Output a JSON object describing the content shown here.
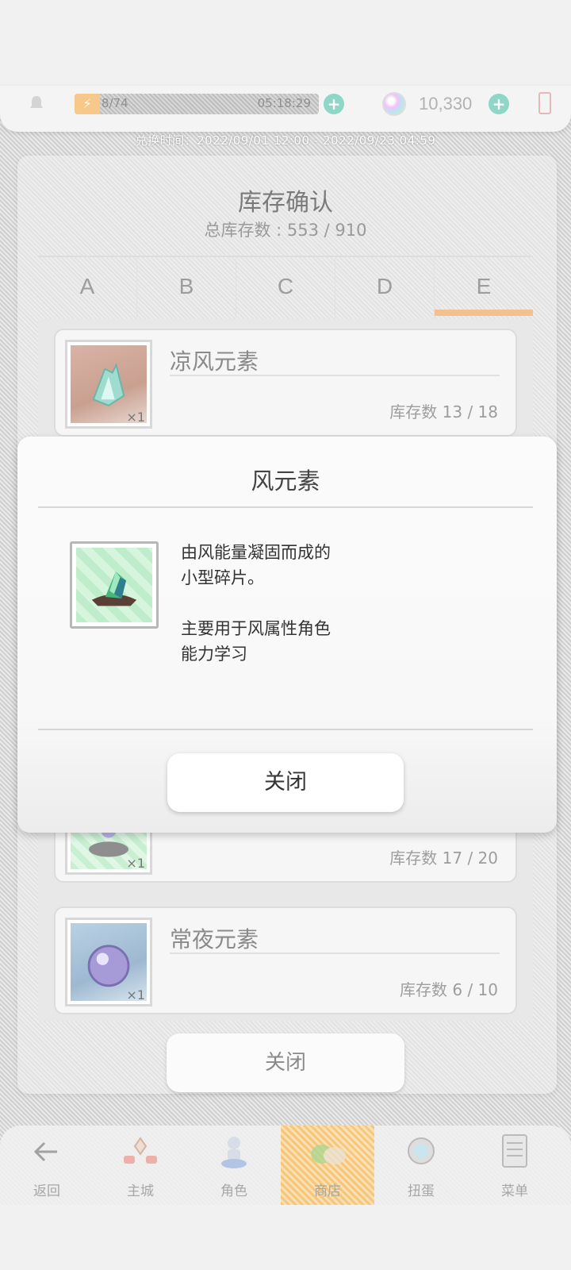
{
  "status": {
    "stamina_current": "8/74",
    "stamina_timer": "05:18:29",
    "gems": "10,330"
  },
  "exchange_period": "兑换时间：2022/09/01 12:00 - 2022/09/23 04:59",
  "inventory": {
    "title": "库存确认",
    "total": "总库存数 : 553 / 910",
    "tabs": [
      "A",
      "B",
      "C",
      "D",
      "E"
    ],
    "active_tab": "E",
    "items": [
      {
        "name": "凉风元素",
        "qty": "×1",
        "stock": "库存数 13 / 18",
        "icon": "cool-wind-element-icon"
      },
      {
        "name": "",
        "qty": "×1",
        "stock": "库存数 17 / 20",
        "icon": "element-orb-icon"
      },
      {
        "name": "常夜元素",
        "qty": "×1",
        "stock": "库存数 6 / 10",
        "icon": "eternal-night-element-icon"
      }
    ],
    "close_label": "关闭"
  },
  "modal": {
    "title": "风元素",
    "icon": "wind-element-shard-icon",
    "description": "由风能量凝固而成的\n小型碎片。\n\n主要用于风属性角色\n能力学习",
    "close_label": "关闭"
  },
  "nav": [
    {
      "label": "返回",
      "icon": "back-arrow-icon"
    },
    {
      "label": "主城",
      "icon": "main-city-icon"
    },
    {
      "label": "角色",
      "icon": "character-icon"
    },
    {
      "label": "商店",
      "icon": "shop-icon",
      "active": true
    },
    {
      "label": "扭蛋",
      "icon": "gacha-icon"
    },
    {
      "label": "菜单",
      "icon": "menu-icon"
    }
  ],
  "colors": {
    "accent_tab": "#f3c190",
    "plus_button": "#8fd6c8",
    "active_nav": "#f6c67d"
  }
}
